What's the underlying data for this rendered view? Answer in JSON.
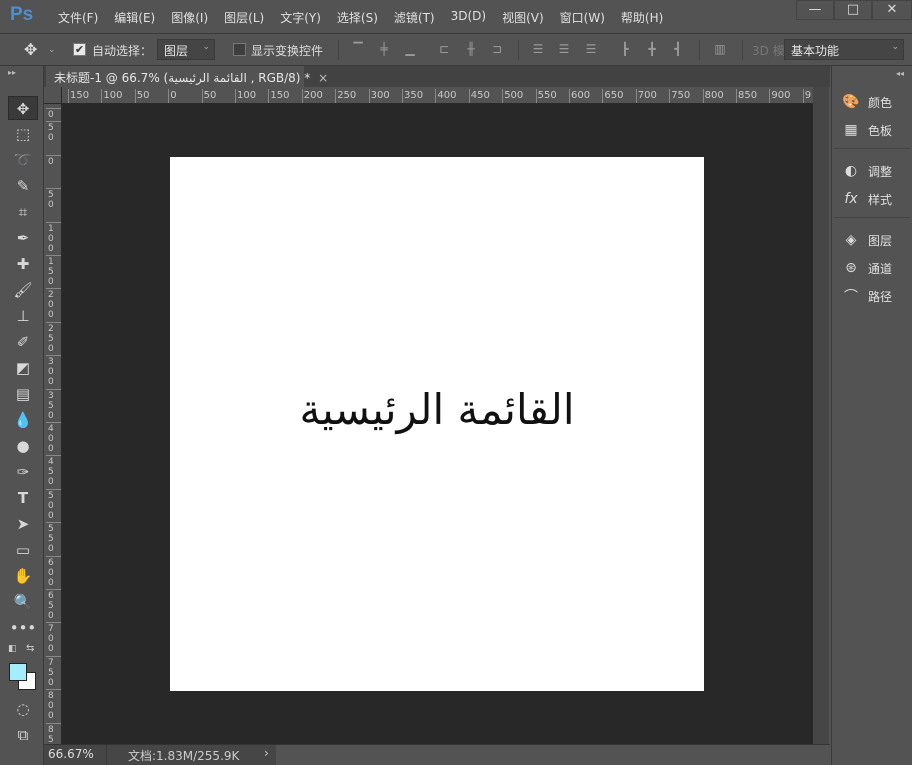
{
  "app": {
    "logo": "Ps",
    "menu": [
      "文件(F)",
      "编辑(E)",
      "图像(I)",
      "图层(L)",
      "文字(Y)",
      "选择(S)",
      "滤镜(T)",
      "3D(D)",
      "视图(V)",
      "窗口(W)",
      "帮助(H)"
    ],
    "window_controls": [
      "minimize",
      "maximize",
      "close"
    ]
  },
  "options": {
    "auto_select_label": "自动选择：",
    "auto_select_checked": true,
    "auto_select_target": "图层",
    "show_transform_label": "显示变换控件",
    "show_transform_checked": false,
    "mode_3d_label": "3D 模",
    "workspace": "基本功能"
  },
  "document": {
    "tab_title": "未标题-1 @ 66.7% (القائمة الرئيسية , RGB/8) *",
    "canvas_text": "القائمة الرئيسية"
  },
  "rulers": {
    "horizontal": [
      "150",
      "100",
      "50",
      "0",
      "50",
      "100",
      "150",
      "200",
      "250",
      "300",
      "350",
      "400",
      "450",
      "500",
      "550",
      "600",
      "650",
      "700",
      "750",
      "800",
      "850",
      "900",
      "9"
    ],
    "vertical": [
      "0",
      "50",
      "0",
      "50",
      "100",
      "150",
      "200",
      "250",
      "300",
      "350",
      "400",
      "450",
      "500",
      "550",
      "600",
      "650",
      "700",
      "750",
      "800",
      "85"
    ]
  },
  "status": {
    "zoom": "66.67%",
    "doc_info": "文档:1.83M/255.9K"
  },
  "colors": {
    "foreground": "#a6ecff",
    "background": "#ffffff"
  },
  "tools": [
    "move",
    "rectangular-marquee",
    "lasso",
    "quick-selection",
    "crop",
    "eyedropper",
    "spot-healing",
    "brush",
    "clone-stamp",
    "history-brush",
    "eraser",
    "gradient",
    "blur",
    "dodge",
    "pen",
    "type",
    "path-selection",
    "rectangle",
    "hand",
    "zoom",
    "more"
  ],
  "panels": [
    {
      "label": "颜色",
      "icon": "palette"
    },
    {
      "label": "色板",
      "icon": "grid"
    },
    {
      "label": "调整",
      "icon": "adjust"
    },
    {
      "label": "样式",
      "icon": "fx"
    },
    {
      "label": "图层",
      "icon": "layers"
    },
    {
      "label": "通道",
      "icon": "channels"
    },
    {
      "label": "路径",
      "icon": "paths"
    }
  ]
}
